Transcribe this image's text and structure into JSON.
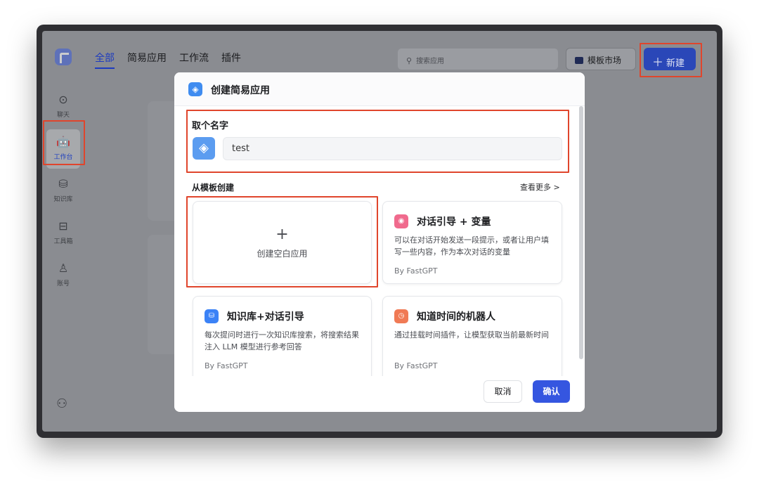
{
  "top_tabs": [
    "全部",
    "简易应用",
    "工作流",
    "插件"
  ],
  "search": {
    "placeholder": "搜索应用"
  },
  "market_button": "模板市场",
  "new_button": "新建",
  "sidebar": {
    "items": [
      {
        "label": "聊天",
        "icon": "chat-icon"
      },
      {
        "label": "工作台",
        "icon": "robot-icon"
      },
      {
        "label": "知识库",
        "icon": "database-icon"
      },
      {
        "label": "工具箱",
        "icon": "toolbox-icon"
      },
      {
        "label": "账号",
        "icon": "user-icon"
      }
    ],
    "active_item": "工作台"
  },
  "modal": {
    "title": "创建简易应用",
    "name_label": "取个名字",
    "name_value": "test",
    "template_label": "从模板创建",
    "see_more": "查看更多 >",
    "blank_card": {
      "plus": "+",
      "label": "创建空白应用"
    },
    "templates": [
      {
        "title": "对话引导 + 变量",
        "desc": "可以在对话开始发送一段提示，或者让用户填写一些内容，作为本次对话的变量",
        "by": "By FastGPT",
        "icon_color": "#f06a8d"
      },
      {
        "title": "知识库+对话引导",
        "desc": "每次提问时进行一次知识库搜索，将搜索结果注入 LLM 模型进行参考回答",
        "by": "By FastGPT",
        "icon_color": "#3b82f6"
      },
      {
        "title": "知道时间的机器人",
        "desc": "通过挂载时间插件，让模型获取当前最新时间",
        "by": "By FastGPT",
        "icon_color": "#f07a55"
      }
    ],
    "cancel": "取消",
    "confirm": "确认"
  }
}
